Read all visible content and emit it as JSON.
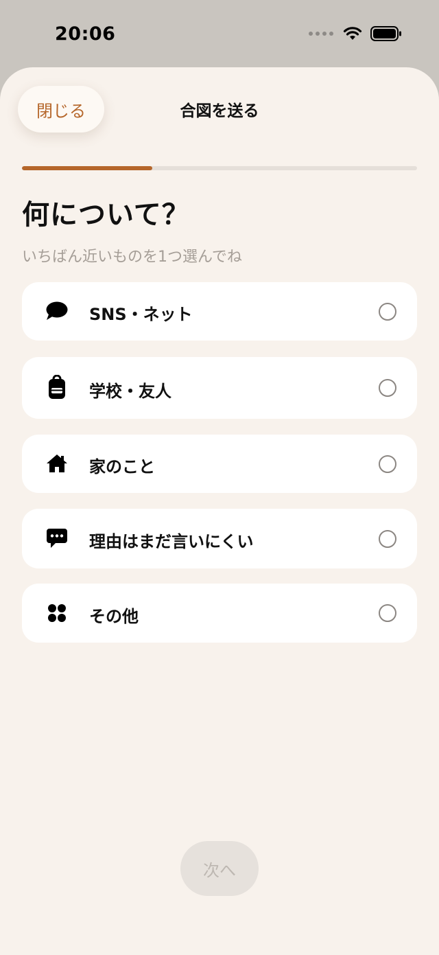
{
  "status_bar": {
    "time": "20:06"
  },
  "header": {
    "close_label": "閉じる",
    "title": "合図を送る"
  },
  "progress": {
    "fraction": 0.33
  },
  "question": {
    "title": "何について？",
    "hint": "いちばん近いものを1つ選んでね"
  },
  "options": [
    {
      "label": "SNS・ネット",
      "icon": "chat-bubble-icon"
    },
    {
      "label": "学校・友人",
      "icon": "backpack-icon"
    },
    {
      "label": "家のこと",
      "icon": "house-icon"
    },
    {
      "label": "理由はまだ言いにくい",
      "icon": "speech-dots-icon"
    },
    {
      "label": "その他",
      "icon": "grid-dots-icon"
    }
  ],
  "footer": {
    "next_label": "次へ"
  },
  "colors": {
    "accent": "#b5662a",
    "sheet_background": "#f8f2ec",
    "card_background": "#ffffff",
    "hint_text": "#a59e97",
    "disabled_button": "#e6e1dc"
  }
}
